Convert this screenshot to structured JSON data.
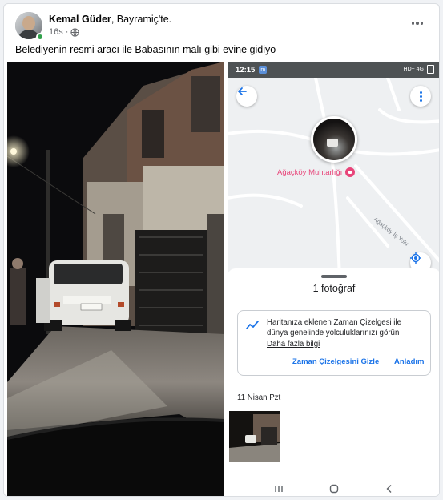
{
  "post": {
    "author": "Kemal Güder",
    "location_suffix": ", Bayramiç'te.",
    "time": "16s",
    "caption": "Belediyenin resmi aracı ile Babasının malı gibi evine gidiyo"
  },
  "phone": {
    "status_time": "12:15",
    "status_badge": "m",
    "status_right": "HD+ 4G",
    "map": {
      "poi_label": "Ağaçköy Muhtarlığı",
      "road_label": "Ağaçköy İç Yolu"
    },
    "sheet": {
      "photo_count": "1 fotoğraf",
      "card_text": "Haritanıza eklenen Zaman Çizelgesi ile dünya genelinde yolculuklarınızı görün",
      "card_link": "Daha fazla bilgi",
      "hide_button": "Zaman Çizelgesini Gizle",
      "ok_button": "Anladım",
      "date_label": "11 Nisan Pzt"
    }
  },
  "icons": {
    "avatar": "profile-photo",
    "globe": "globe-icon",
    "more": "more-horizontal-icon",
    "back": "arrow-left-icon",
    "map_more": "more-vertical-icon",
    "poi": "place-marker-icon",
    "locate": "my-location-icon",
    "timeline": "timeline-icon",
    "nav_recent": "recent-apps-icon",
    "nav_home": "home-icon",
    "nav_back": "back-icon"
  },
  "colors": {
    "accent": "#1a73e8",
    "poi": "#e8457a",
    "online": "#31a24c"
  }
}
